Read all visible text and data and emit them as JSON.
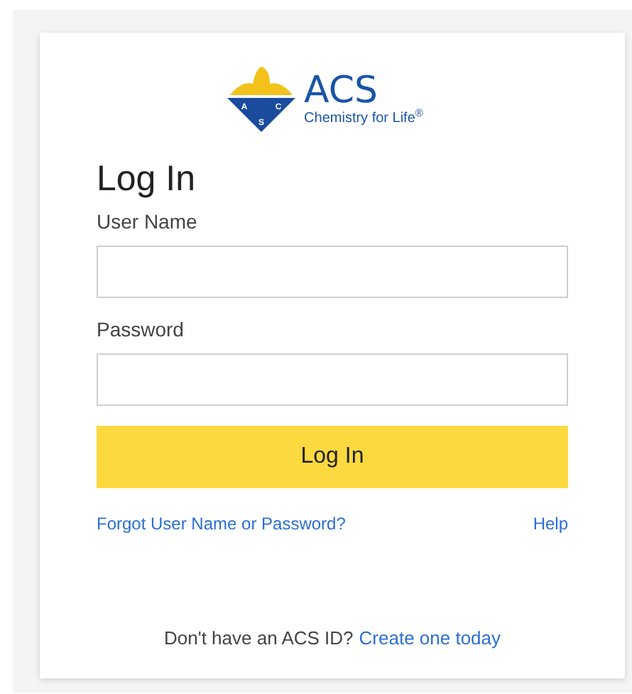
{
  "logo": {
    "emblem_letters": [
      "A",
      "C",
      "S"
    ],
    "name": "ACS",
    "tagline": "Chemistry for Life$^{®}$"
  },
  "title": "Log In",
  "fields": [
    {
      "label": "User Name"
    },
    {
      "label": "Password"
    }
  ],
  "submit": "Log In",
  "links": {
    "forgot": "Forgot User Name or Password?",
    "help": "Help"
  },
  "signup": {
    "text": "Don't have an ACS ID?",
    "link": "Create one today"
  }
}
